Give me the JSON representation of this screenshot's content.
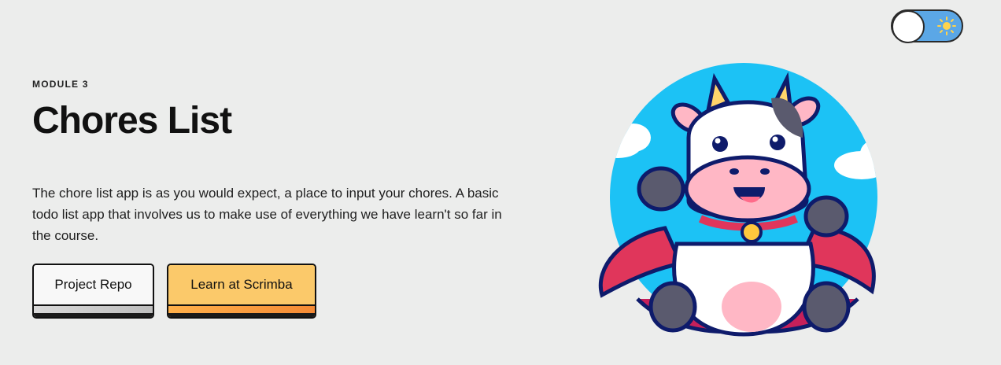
{
  "theme_toggle": {
    "state": "light",
    "icon": "sun-icon",
    "track_color": "#5ba7e6"
  },
  "hero": {
    "eyebrow": "MODULE 3",
    "title": "Chores List",
    "description": "The chore list app is as you would expect, a place to input your chores. A basic todo list app that involves us to make use of everything we have learn't so far in the course."
  },
  "buttons": {
    "repo_label": "Project Repo",
    "scrimba_label": "Learn at Scrimba"
  },
  "illustration": {
    "subject": "superhero-cow-illustration",
    "circle_color": "#1cc2f5"
  },
  "colors": {
    "background": "#ecedec",
    "accent": "#fbc96a",
    "text": "#111111"
  }
}
